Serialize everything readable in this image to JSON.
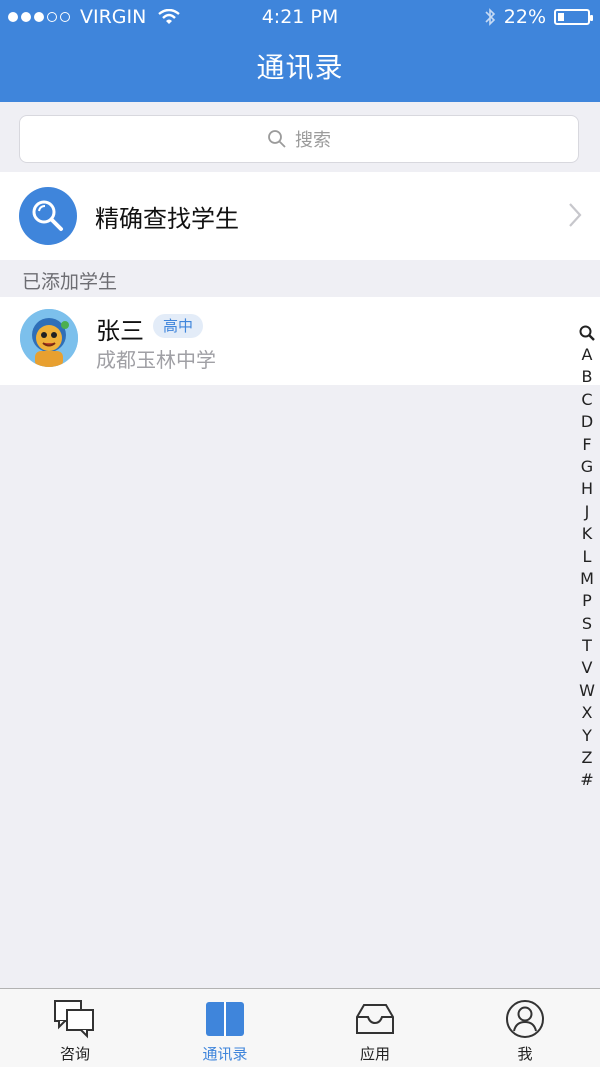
{
  "status_bar": {
    "carrier": "VIRGIN",
    "signal_filled": 3,
    "signal_total": 5,
    "time": "4:21 PM",
    "battery_text": "22%",
    "battery_level": 0.22
  },
  "nav": {
    "title": "通讯录"
  },
  "search": {
    "placeholder": "搜索"
  },
  "exact_search": {
    "label": "精确查找学生"
  },
  "section": {
    "title": "已添加学生"
  },
  "students": [
    {
      "name": "张三",
      "badge": "高中",
      "school": "成都玉林中学"
    }
  ],
  "alpha_index": [
    "A",
    "B",
    "C",
    "D",
    "F",
    "G",
    "H",
    "J",
    "K",
    "L",
    "M",
    "P",
    "S",
    "T",
    "V",
    "W",
    "X",
    "Y",
    "Z",
    "#"
  ],
  "tabs": [
    {
      "label": "咨询",
      "icon": "chat-icon",
      "active": false
    },
    {
      "label": "通讯录",
      "icon": "book-icon",
      "active": true
    },
    {
      "label": "应用",
      "icon": "inbox-icon",
      "active": false
    },
    {
      "label": "我",
      "icon": "profile-icon",
      "active": false
    }
  ],
  "colors": {
    "accent": "#3f85db",
    "background": "#efeff4",
    "badge_bg": "#e3ecf8",
    "secondary_text": "#a0a0a5"
  }
}
